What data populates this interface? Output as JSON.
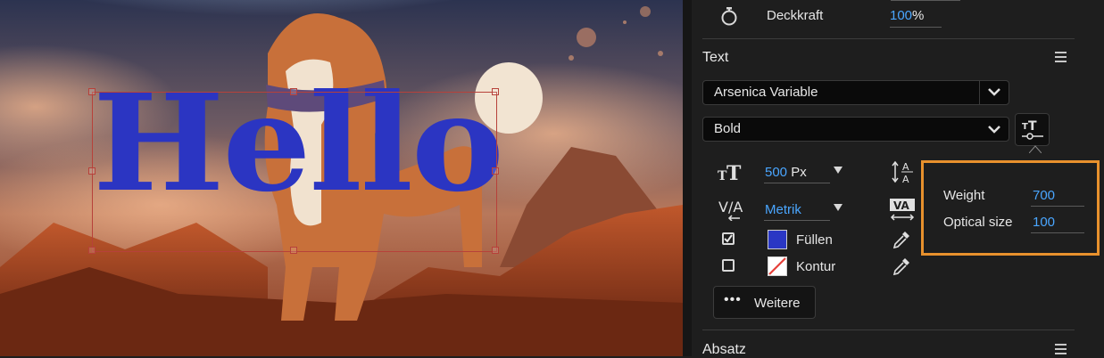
{
  "canvas": {
    "text_content": "Hello",
    "text_color": "#2b35c2"
  },
  "panel": {
    "opacity": {
      "icon": "stopwatch-icon",
      "label": "Deckkraft",
      "value": "100",
      "unit": "%"
    },
    "text_section": {
      "title": "Text",
      "font_family": "Arsenica Variable",
      "font_style": "Bold",
      "font_size_value": "500",
      "font_size_unit": "Px",
      "kerning": "Metrik",
      "fill_label": "Füllen",
      "fill_checked": true,
      "fill_color": "#2a37c4",
      "stroke_label": "Kontur",
      "stroke_checked": false,
      "more_button": "Weitere",
      "variable_axes": [
        {
          "label": "Weight",
          "value": "700"
        },
        {
          "label": "Optical size",
          "value": "100"
        }
      ]
    },
    "paragraph_section": {
      "title": "Absatz"
    }
  },
  "colors": {
    "accent_blue": "#4aa6ff",
    "highlight_orange": "#e8912d"
  }
}
